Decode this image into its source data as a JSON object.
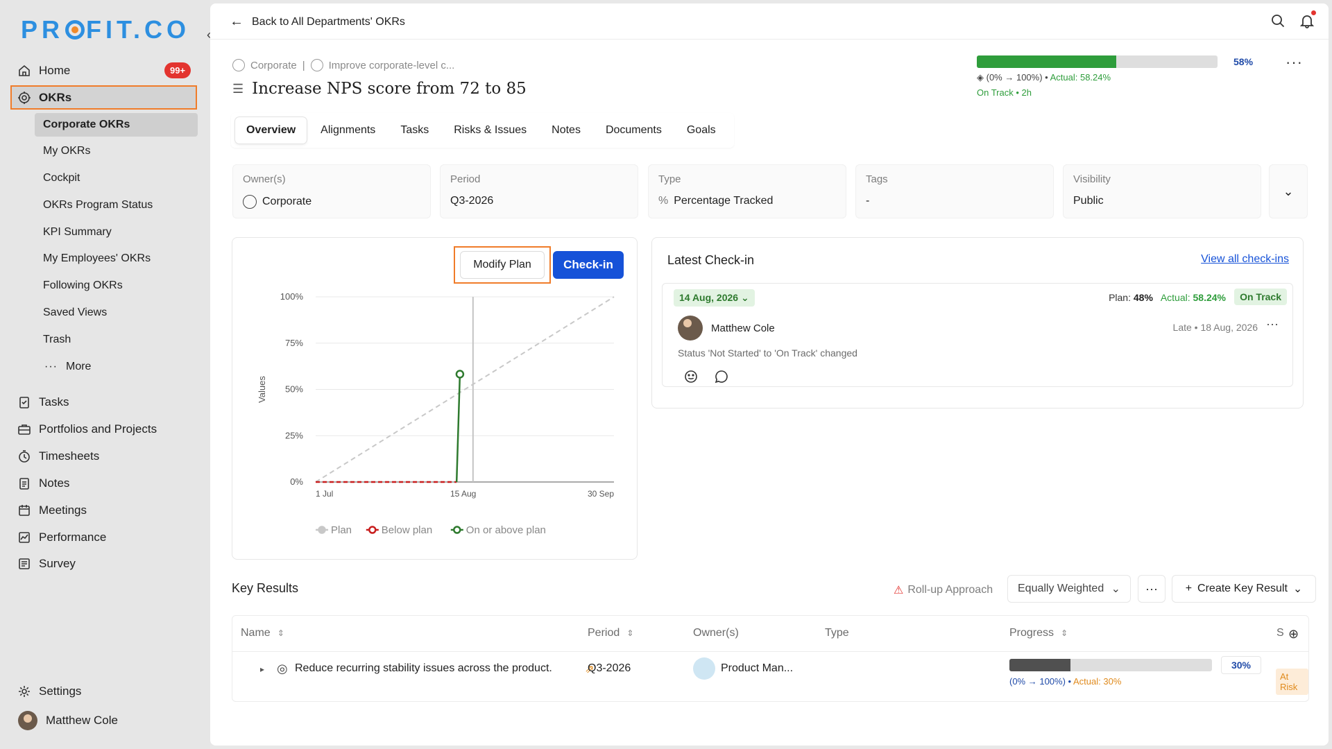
{
  "brand": {
    "logo_text_a": "PR",
    "logo_text_b": "FIT.CO",
    "accent": "#2d8fe0",
    "secondary": "#f08a2a"
  },
  "sidebar": {
    "home": "Home",
    "home_badge": "99+",
    "okrs": "OKRs",
    "okr_subitems": [
      "Corporate OKRs",
      "My OKRs",
      "Cockpit",
      "OKRs Program Status",
      "KPI Summary",
      "My Employees' OKRs",
      "Following OKRs",
      "Saved Views",
      "Trash"
    ],
    "more": "More",
    "items": [
      "Tasks",
      "Portfolios and Projects",
      "Timesheets",
      "Notes",
      "Meetings",
      "Performance",
      "Survey"
    ],
    "settings": "Settings",
    "user": "Matthew Cole"
  },
  "topbar": {
    "back": "Back to All Departments' OKRs"
  },
  "okr": {
    "crumb_a": "Corporate",
    "crumb_sep": "|",
    "crumb_b": "Improve corporate-level c...",
    "title": "Increase NPS score from 72 to 85",
    "progress_pct": 58,
    "progress_label": "58%",
    "range": "(0% → 100%)",
    "actual": "Actual: 58.24%",
    "status": "On Track • 2h"
  },
  "tabs": [
    "Overview",
    "Alignments",
    "Tasks",
    "Risks & Issues",
    "Notes",
    "Documents",
    "Goals"
  ],
  "info": [
    {
      "label": "Owner(s)",
      "value": "Corporate"
    },
    {
      "label": "Period",
      "value": "Q3-2026"
    },
    {
      "label": "Type",
      "value": "Percentage Tracked"
    },
    {
      "label": "Tags",
      "value": "-"
    },
    {
      "label": "Visibility",
      "value": "Public"
    }
  ],
  "chart": {
    "modify": "Modify Plan",
    "checkin": "Check-in"
  },
  "chart_data": {
    "type": "line",
    "ylabel": "Values",
    "yticks": [
      "0%",
      "25%",
      "50%",
      "75%",
      "100%"
    ],
    "ylim": [
      0,
      100
    ],
    "xticks": [
      "1 Jul",
      "15 Aug",
      "30 Sep"
    ],
    "x_range": [
      "1 Jul",
      "30 Sep"
    ],
    "today_marker": "18 Aug",
    "series": [
      {
        "name": "Plan",
        "color": "#c8c8c8",
        "style": "dashed",
        "points": [
          [
            "1 Jul",
            0
          ],
          [
            "30 Sep",
            100
          ]
        ]
      },
      {
        "name": "Below plan",
        "color": "#c81e1e",
        "style": "dashed",
        "points": [
          [
            "1 Jul",
            0
          ],
          [
            "13 Aug",
            0
          ]
        ]
      },
      {
        "name": "On or above plan",
        "color": "#2e7a2e",
        "style": "solid",
        "points": [
          [
            "13 Aug",
            0
          ],
          [
            "14 Aug",
            58.24
          ]
        ]
      }
    ],
    "legend": [
      "Plan",
      "Below plan",
      "On or above plan"
    ],
    "legend_position": "bottom",
    "grid": true
  },
  "latest": {
    "title": "Latest Check-in",
    "view_all": "View all check-ins",
    "date": "14 Aug, 2026",
    "plan_label": "Plan:",
    "plan_val": "48%",
    "actual_label": "Actual:",
    "actual_val": "58.24%",
    "status": "On Track",
    "user": "Matthew Cole",
    "when": "Late • 18 Aug, 2026",
    "change": "Status 'Not Started' to 'On Track' changed"
  },
  "kr": {
    "title": "Key Results",
    "rollup": "Roll-up Approach",
    "weighting": "Equally Weighted",
    "create": "Create Key Result",
    "columns": {
      "name": "Name",
      "period": "Period",
      "owners": "Owner(s)",
      "type": "Type",
      "progress": "Progress",
      "s": "S"
    },
    "row": {
      "name": "Reduce recurring stability issues across the product.",
      "period": "Q3-2026",
      "owner": "Product Man...",
      "progress_pct": 30,
      "progress_label": "30%",
      "range": "(0% → 100%) •",
      "actual": "Actual: 30%",
      "status": "At Risk"
    }
  }
}
